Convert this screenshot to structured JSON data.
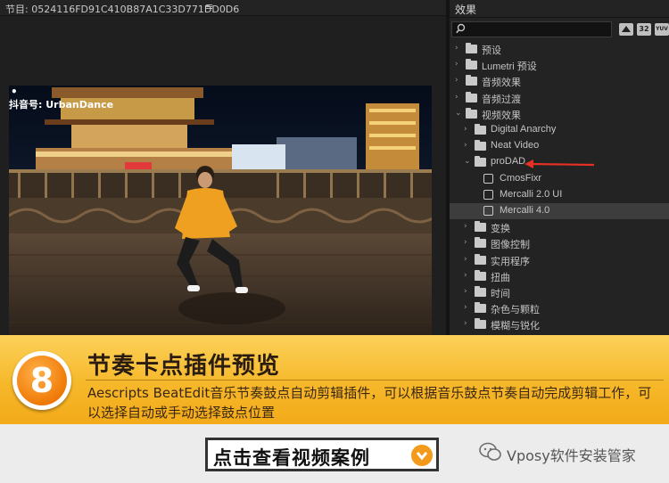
{
  "program_monitor": {
    "title": "节目: 0524116FD91C410B87A1C33D771DD0D6",
    "menu_icon": "≡",
    "watermark_line1": "•",
    "watermark_line2": "抖音号: UrbanDance"
  },
  "effects_panel": {
    "title": "效果",
    "toolbar": [
      "32",
      "YUV"
    ],
    "items": [
      {
        "label": "预设",
        "type": "special-folder",
        "level": 0,
        "expanded": false
      },
      {
        "label": "Lumetri 预设",
        "type": "special-folder",
        "level": 0,
        "expanded": false
      },
      {
        "label": "音频效果",
        "type": "folder",
        "level": 0,
        "expanded": false
      },
      {
        "label": "音频过渡",
        "type": "folder",
        "level": 0,
        "expanded": false
      },
      {
        "label": "视频效果",
        "type": "folder",
        "level": 0,
        "expanded": true
      },
      {
        "label": "Digital Anarchy",
        "type": "folder",
        "level": 1,
        "expanded": false
      },
      {
        "label": "Neat Video",
        "type": "folder",
        "level": 1,
        "expanded": false
      },
      {
        "label": "proDAD",
        "type": "folder",
        "level": 1,
        "expanded": true
      },
      {
        "label": "CmosFixr",
        "type": "effect",
        "level": 2
      },
      {
        "label": "Mercalli 2.0 UI",
        "type": "effect",
        "level": 2
      },
      {
        "label": "Mercalli 4.0",
        "type": "effect",
        "level": 2,
        "selected": true
      },
      {
        "label": "变换",
        "type": "folder",
        "level": 1,
        "expanded": false
      },
      {
        "label": "图像控制",
        "type": "folder",
        "level": 1,
        "expanded": false
      },
      {
        "label": "实用程序",
        "type": "folder",
        "level": 1,
        "expanded": false
      },
      {
        "label": "扭曲",
        "type": "folder",
        "level": 1,
        "expanded": false
      },
      {
        "label": "时间",
        "type": "folder",
        "level": 1,
        "expanded": false
      },
      {
        "label": "杂色与颗粒",
        "type": "folder",
        "level": 1,
        "expanded": false
      },
      {
        "label": "模糊与锐化",
        "type": "folder",
        "level": 1,
        "expanded": false
      }
    ],
    "annotation_color": "#e53024"
  },
  "banner": {
    "number": "8",
    "title": "节奏卡点插件预览",
    "description": "Aescripts BeatEdit音乐节奏鼓点自动剪辑插件，可以根据音乐鼓点节奏自动完成剪辑工作，可以选择自动或手动选择鼓点位置",
    "accent": "#f39a1c"
  },
  "footer": {
    "cta_label": "点击查看视频案例",
    "cta_icon": "chevron-down-icon",
    "brand": "Vposy软件安装管家"
  }
}
